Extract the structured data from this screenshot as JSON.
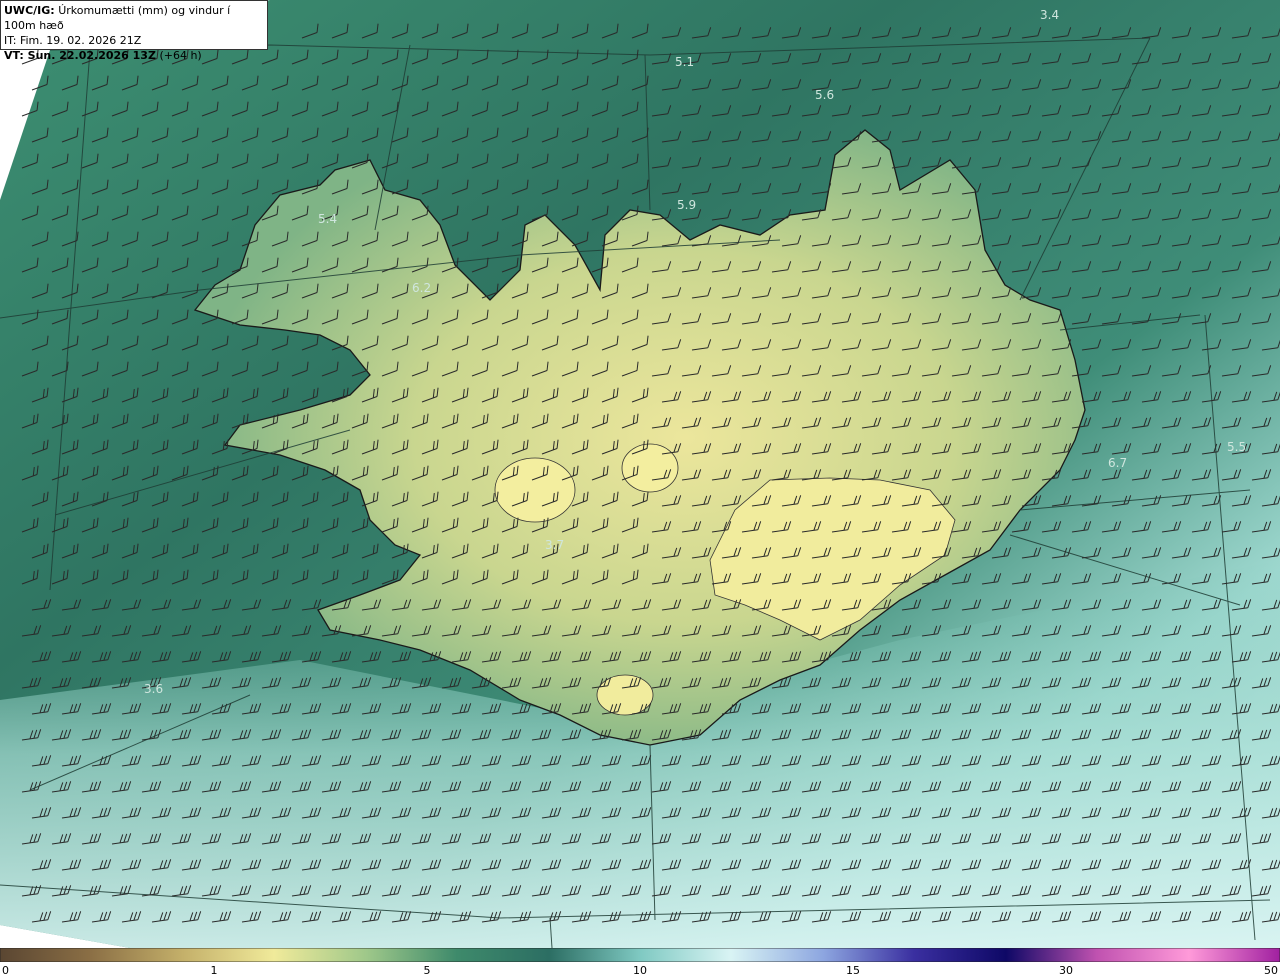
{
  "info": {
    "line1_bold": "UWC/IG:",
    "line1_rest": "Úrkomumætti (mm) og vindur í 100m hæð",
    "line2": "IT: Fim. 19. 02. 2026 21Z",
    "line3_bold": "VT: Sun. 22.02.2026 13Z",
    "line3_rest": "(+64 h)"
  },
  "map_values": [
    "3.4",
    "5.1",
    "5.6",
    "5.4",
    "5.9",
    "6.2",
    "3.7",
    "6.7",
    "5.5",
    "3.6"
  ],
  "colorbar": {
    "ticks": [
      "0",
      "1",
      "5",
      "10",
      "15",
      "30",
      "50"
    ],
    "colors": [
      "#5a4632",
      "#8b6f45",
      "#c4b06a",
      "#f0ea9a",
      "#9fc88a",
      "#3e8a6b",
      "#2c6e63",
      "#7fc9c2",
      "#d9f4f4",
      "#8da6e0",
      "#3a2fa0",
      "#0e0866",
      "#c052b0",
      "#ff9ad9",
      "#a020a0"
    ]
  },
  "colors": {
    "land_light": "#e8e39a",
    "sea_dark": "#2f7562",
    "sea_mid": "#5aa889",
    "sea_light": "#cfeeea",
    "coast": "#1a1a1a",
    "barb": "#2a2a2a"
  }
}
